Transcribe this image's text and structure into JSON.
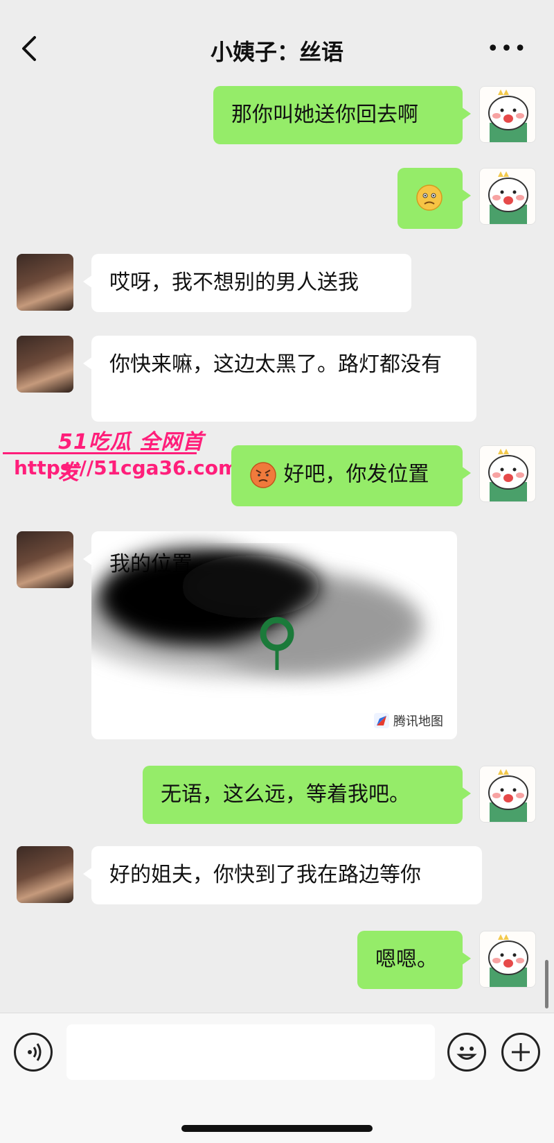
{
  "header": {
    "title": "小姨子：丝语"
  },
  "messages": [
    {
      "side": "right",
      "text": "那你叫她送你回去啊"
    },
    {
      "side": "right",
      "text": "",
      "emoji": "worried-face"
    },
    {
      "side": "left",
      "text": "哎呀，我不想别的男人送我"
    },
    {
      "side": "left",
      "text": "你快来嘛，这边太黑了。路灯都没有"
    },
    {
      "side": "right",
      "text": "好吧，你发位置",
      "emoji": "angry-face"
    },
    {
      "side": "left",
      "type": "location",
      "title": "我的位置",
      "provider": "腾讯地图"
    },
    {
      "side": "right",
      "text": "无语，这么远，等着我吧。"
    },
    {
      "side": "left",
      "text": "好的姐夫，你快到了我在路边等你"
    },
    {
      "side": "right",
      "text": "嗯嗯。"
    }
  ],
  "watermark": {
    "line1": "51吃瓜 全网首发",
    "line2": "https://51cga36.com"
  },
  "colors": {
    "bubble_me": "#95ec69",
    "bubble_other": "#ffffff",
    "background": "#ededed",
    "watermark": "#ff1e7a"
  }
}
